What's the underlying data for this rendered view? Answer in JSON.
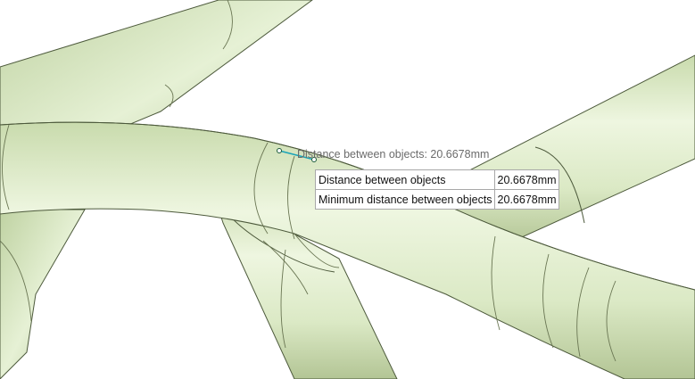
{
  "measurement": {
    "annotation": "Distance between objects: 20.6678mm",
    "rows": [
      {
        "label": "Distance between objects",
        "value": "20.6678mm"
      },
      {
        "label": "Minimum distance between objects",
        "value": "20.6678mm"
      }
    ]
  },
  "colors": {
    "tube_fill": "#e3efcf",
    "tube_shadow": "#b7c89b",
    "edge": "#4d5a3c",
    "measure_line": "#1aa3b8",
    "background": "#ffffff"
  }
}
